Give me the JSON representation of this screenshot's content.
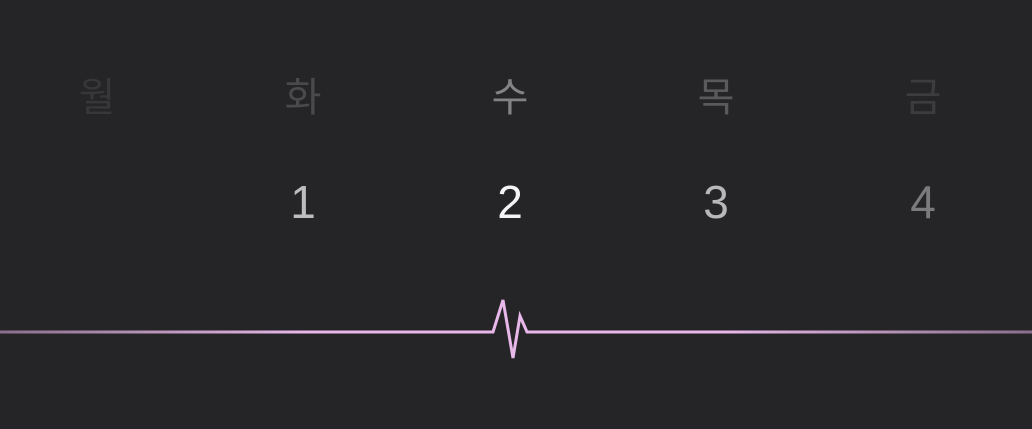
{
  "week": {
    "days": [
      {
        "weekday": "월",
        "date": "",
        "weekday_color": "#373739",
        "date_color": "#373739"
      },
      {
        "weekday": "화",
        "date": "1",
        "weekday_color": "#4a4a4c",
        "date_color": "#bdbdbf"
      },
      {
        "weekday": "수",
        "date": "2",
        "weekday_color": "#838385",
        "date_color": "#f4f4f6"
      },
      {
        "weekday": "목",
        "date": "3",
        "weekday_color": "#5a5a5c",
        "date_color": "#b8b8ba"
      },
      {
        "weekday": "금",
        "date": "4",
        "weekday_color": "#3c3c3e",
        "date_color": "#7b7b7d"
      }
    ],
    "selected_index": 2
  },
  "heartbeat": {
    "icon": "heartbeat-line-icon",
    "line_color": "#e9b8ea",
    "fade_color": "#8a6f8c",
    "background": "#252527"
  }
}
